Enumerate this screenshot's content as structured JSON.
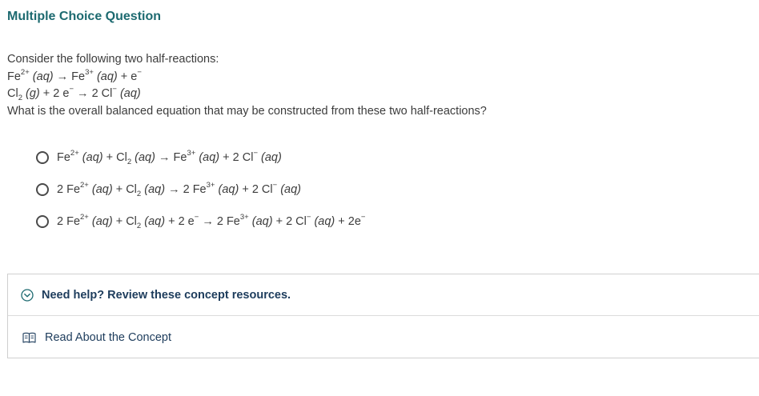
{
  "header": {
    "title": "Multiple Choice Question"
  },
  "question": {
    "intro": "Consider the following two half-reactions:",
    "reaction1": {
      "a": "Fe",
      "a_sup": "2+",
      "a_state": "(aq)",
      "arrow": "→",
      "b": "Fe",
      "b_sup": "3+",
      "b_state": "(aq)",
      "plus": "+ e",
      "e_sup": "−"
    },
    "reaction2": {
      "a": "Cl",
      "a_sub": "2",
      "a_state": "(g)",
      "mid": "+ 2 e",
      "e_sup": "−",
      "arrow": "→",
      "b": "2 Cl",
      "b_sup": "−",
      "b_state": "(aq)"
    },
    "prompt": "What is the overall balanced equation that may be constructed from these two half-reactions?"
  },
  "choices": [
    {
      "p1": "Fe",
      "s1": "2+",
      "st1": "(aq)",
      "p2": "+ Cl",
      "sub2": "2",
      "st2": "(aq)",
      "arrow": "→",
      "p3": "Fe",
      "s3": "3+",
      "st3": "(aq)",
      "p4": "+ 2 Cl",
      "s4": "−",
      "st4": "(aq)"
    },
    {
      "p1": "2 Fe",
      "s1": "2+",
      "st1": "(aq)",
      "p2": "+ Cl",
      "sub2": "2",
      "st2": "(aq)",
      "arrow": "→",
      "p3": "2 Fe",
      "s3": "3+",
      "st3": "(aq)",
      "p4": "+ 2 Cl",
      "s4": "−",
      "st4": "(aq)"
    },
    {
      "p1": "2 Fe",
      "s1": "2+",
      "st1": "(aq)",
      "p2": "+ Cl",
      "sub2": "2",
      "st2": "(aq)",
      "p2b": "+ 2 e",
      "s2b": "−",
      "arrow": "→",
      "p3": "2 Fe",
      "s3": "3+",
      "st3": "(aq)",
      "p4": "+ 2 Cl",
      "s4": "−",
      "st4": "(aq)",
      "p5": "+ 2e",
      "s5": "−"
    }
  ],
  "help": {
    "toggle_label": "Need help? Review these concept resources.",
    "link_label": "Read About the Concept"
  },
  "colors": {
    "title": "#1d6a70",
    "link": "#1d3c5c",
    "border": "#cfcfcf"
  },
  "icons": {
    "toggle": "chevron-down-circle-icon",
    "link": "book-icon"
  }
}
